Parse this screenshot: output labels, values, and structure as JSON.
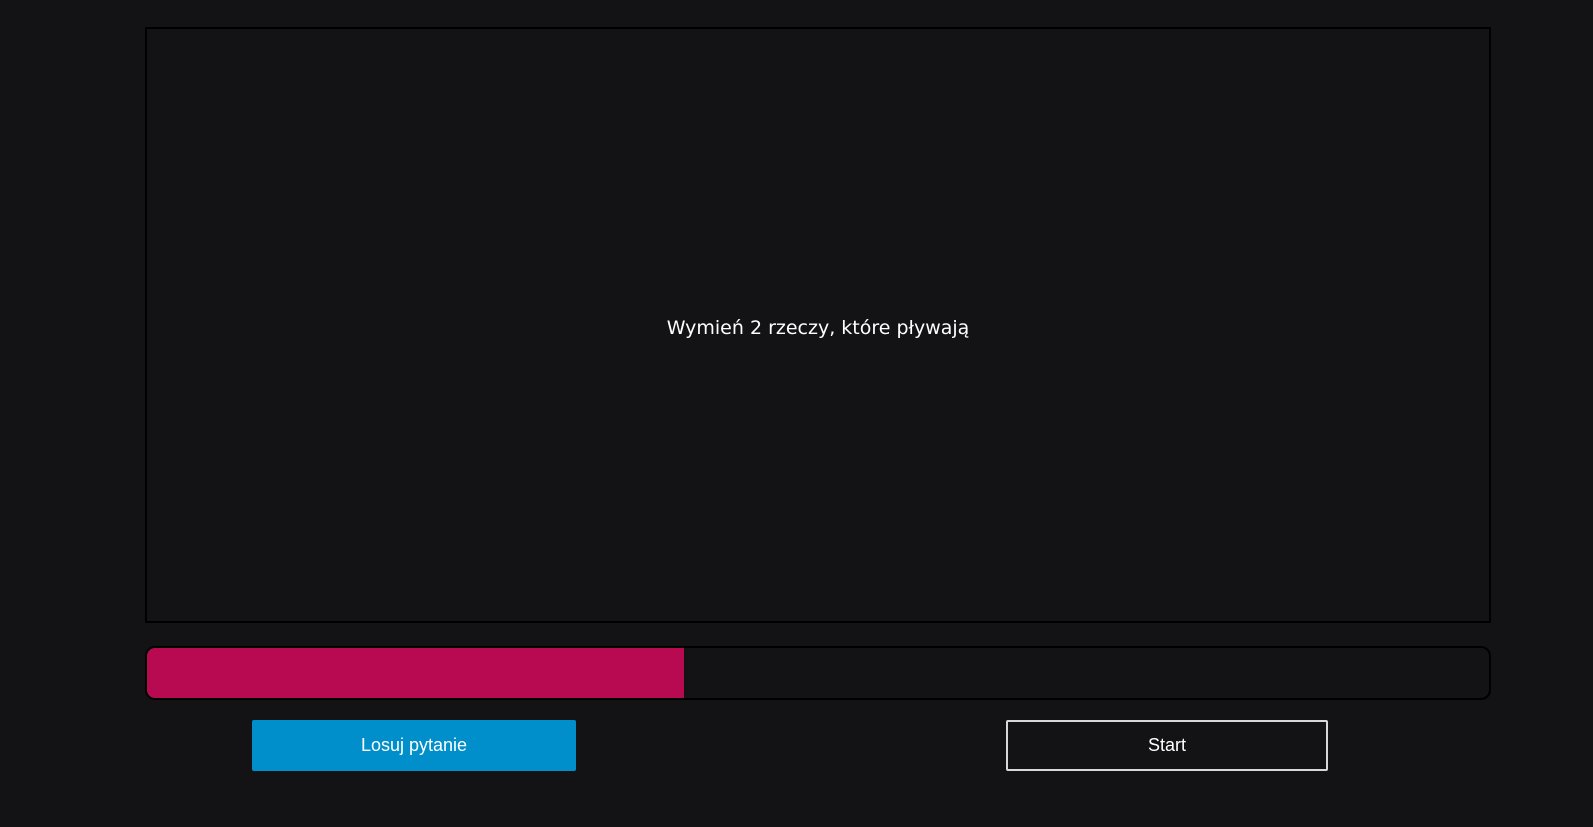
{
  "question": {
    "text": "Wymień 2 rzeczy, które pływają"
  },
  "timer": {
    "progress_percent": 40,
    "fill_color": "#b80a50",
    "track_color": "#131316"
  },
  "buttons": {
    "draw_label": "Losuj pytanie",
    "draw_color": "#008fca",
    "start_label": "Start"
  },
  "theme": {
    "background": "#131316",
    "text_color": "#ffffff"
  }
}
